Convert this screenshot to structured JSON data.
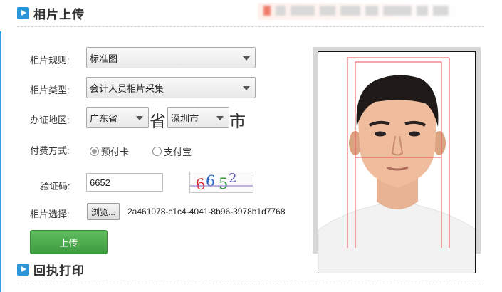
{
  "header": {
    "section1_title": "相片上传",
    "section2_title": "回执打印"
  },
  "form": {
    "rule_label": "相片规则:",
    "rule_value": "标准图",
    "type_label": "相片类型:",
    "type_value": "会计人员相片采集",
    "region_label": "办证地区:",
    "province_value": "广东省",
    "province_suffix": "省",
    "city_value": "深圳市",
    "city_suffix": "市",
    "pay_label": "付费方式:",
    "pay_options": [
      "预付卡",
      "支付宝"
    ],
    "pay_selected": "预付卡",
    "captcha_label": "验证码:",
    "captcha_value": "6652",
    "captcha_image_text": "6652",
    "file_label": "相片选择:",
    "browse_label": "浏览...",
    "file_name": "2a461078-c1c4-4041-8b96-3978b1d7768",
    "upload_label": "上传"
  },
  "colors": {
    "accent": "#2d95d9",
    "upload_button": "#4caf50",
    "guide_lines": "#e8505b"
  }
}
